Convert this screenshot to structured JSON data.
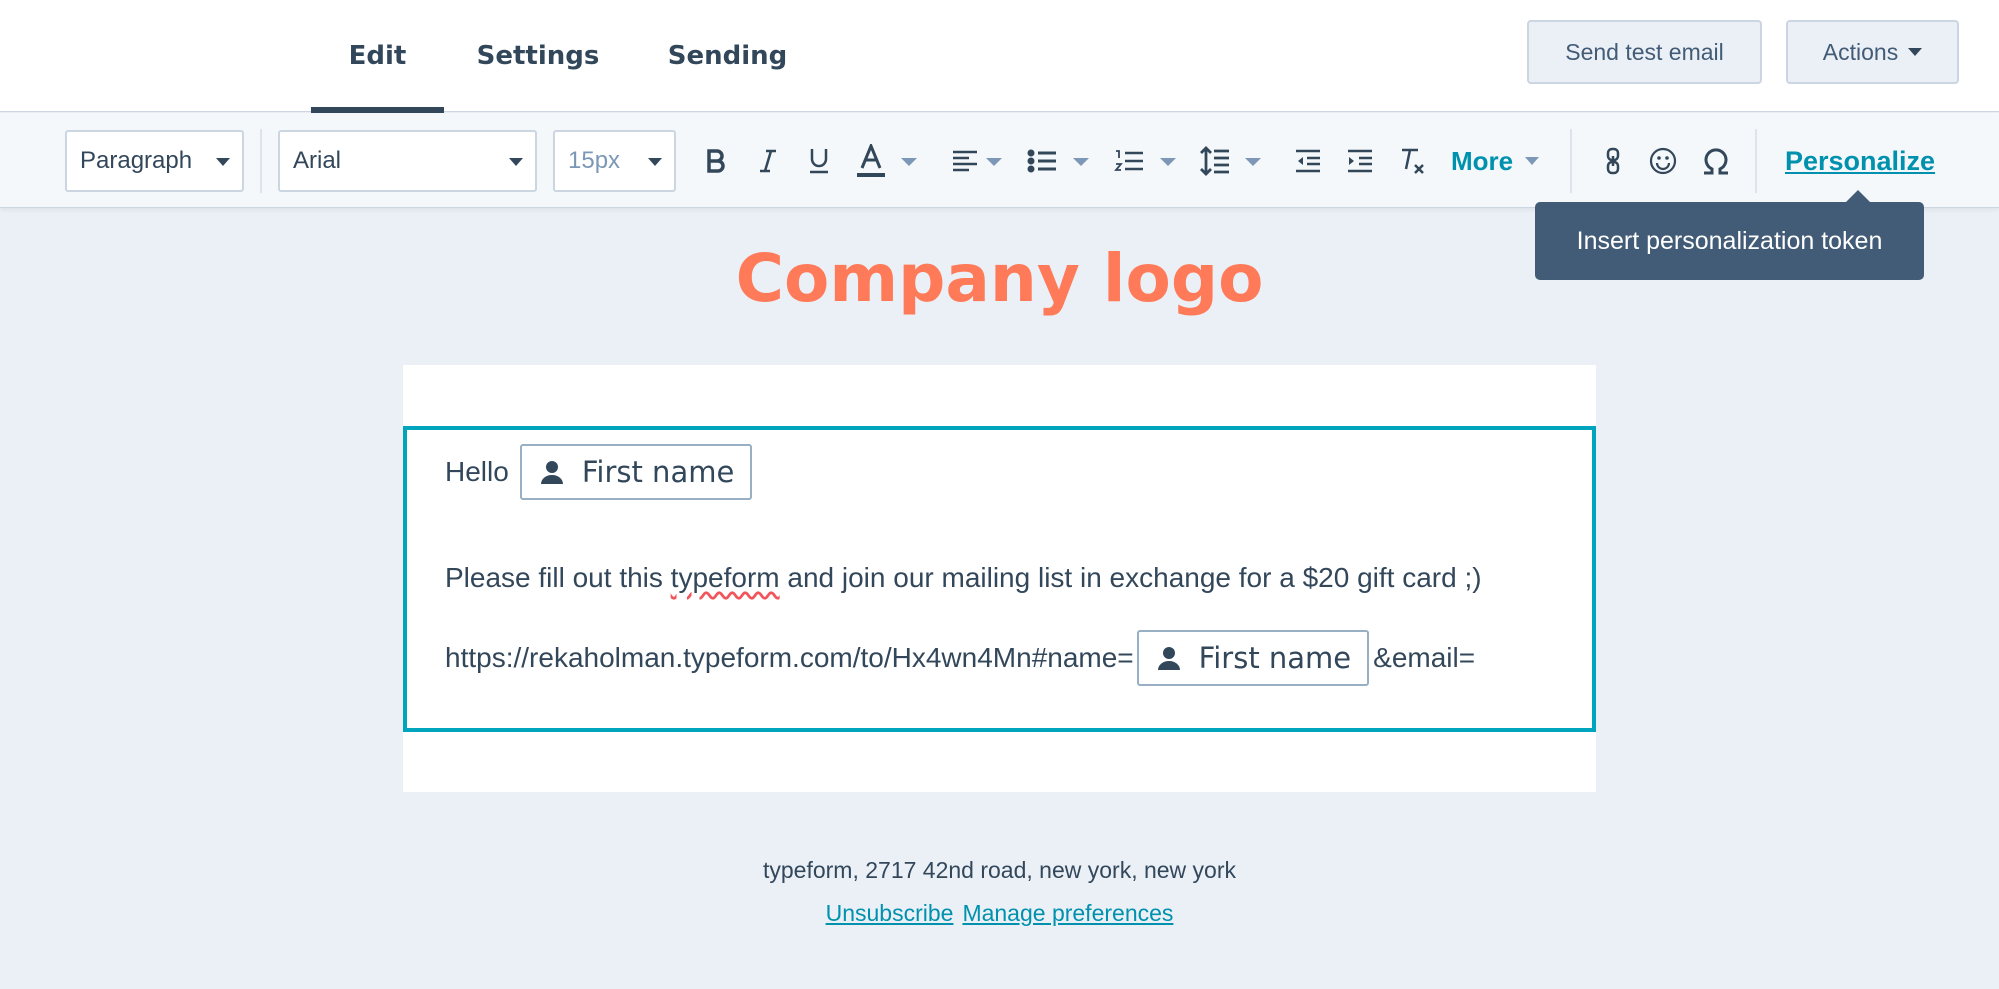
{
  "nav": {
    "tabs": [
      {
        "label": "Edit",
        "active": true
      },
      {
        "label": "Settings",
        "active": false
      },
      {
        "label": "Sending",
        "active": false
      }
    ],
    "send_test_label": "Send test email",
    "actions_label": "Actions"
  },
  "toolbar": {
    "paragraph_value": "Paragraph",
    "font_value": "Arial",
    "size_value": "15px",
    "more_label": "More",
    "personalize_label": "Personalize",
    "icons": [
      "bold-icon",
      "italic-icon",
      "underline-icon",
      "text-color-icon",
      "align-left-icon",
      "bulleted-list-icon",
      "numbered-list-icon",
      "line-height-icon",
      "outdent-icon",
      "indent-icon",
      "clear-format-icon",
      "link-icon",
      "emoji-icon",
      "special-character-icon"
    ]
  },
  "tooltip": {
    "text": "Insert personalization token"
  },
  "email": {
    "logo_text": "Company logo",
    "greeting": "Hello",
    "token_label": "First name",
    "body_before": "Please fill out this ",
    "body_misspelled": "typeform",
    "body_after": " and join our mailing list in exchange for a $20 gift card ;)",
    "url_prefix": "https://rekaholman.typeform.com/to/Hx4wn4Mn#name=",
    "url_suffix": "&email="
  },
  "footer": {
    "address": "typeform, 2717 42nd road, new york, new york",
    "unsubscribe_label": "Unsubscribe",
    "manage_label": "Manage preferences"
  },
  "colors": {
    "accent": "#0091ae",
    "module_border": "#00a4bd",
    "logo": "#ff7a59",
    "text": "#33475b",
    "tooltip_bg": "#425b76"
  }
}
